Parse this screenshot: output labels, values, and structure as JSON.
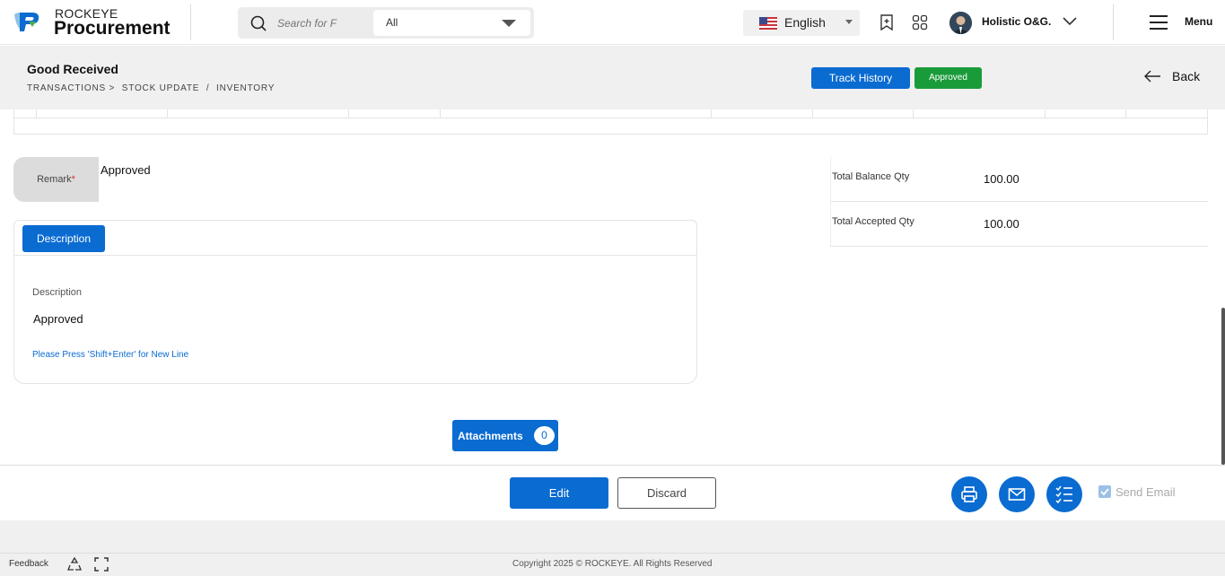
{
  "header": {
    "brand_small": "ROCKEYE",
    "brand_big": "Procurement",
    "search_placeholder": "Search for F",
    "search_scope": "All",
    "language": "English",
    "user_name": "Holistic O&G.",
    "menu_label": "Menu"
  },
  "page": {
    "title": "Good Received",
    "breadcrumb": [
      "TRANSACTIONS >",
      "STOCK UPDATE",
      "/",
      "INVENTORY"
    ],
    "track_history": "Track History",
    "status": "Approved",
    "back": "Back"
  },
  "remark": {
    "label": "Remark",
    "required_mark": "*",
    "value": "Approved"
  },
  "description": {
    "tab": "Description",
    "label": "Description",
    "value": "Approved",
    "hint": "Please Press 'Shift+Enter' for New Line"
  },
  "totals": [
    {
      "label": "Total Balance Qty",
      "value": "100.00"
    },
    {
      "label": "Total Accepted Qty",
      "value": "100.00"
    }
  ],
  "attachments": {
    "label": "Attachments",
    "count": "0"
  },
  "actions": {
    "edit": "Edit",
    "discard": "Discard",
    "send_email": "Send Email",
    "send_email_checked": true
  },
  "footer": {
    "feedback": "Feedback",
    "copyright": "Copyright 2025 © ROCKEYE. All Rights Reserved"
  },
  "colors": {
    "primary": "#0a6bd1",
    "approved": "#1a9b3a",
    "header_bg": "#f0f0f0"
  }
}
